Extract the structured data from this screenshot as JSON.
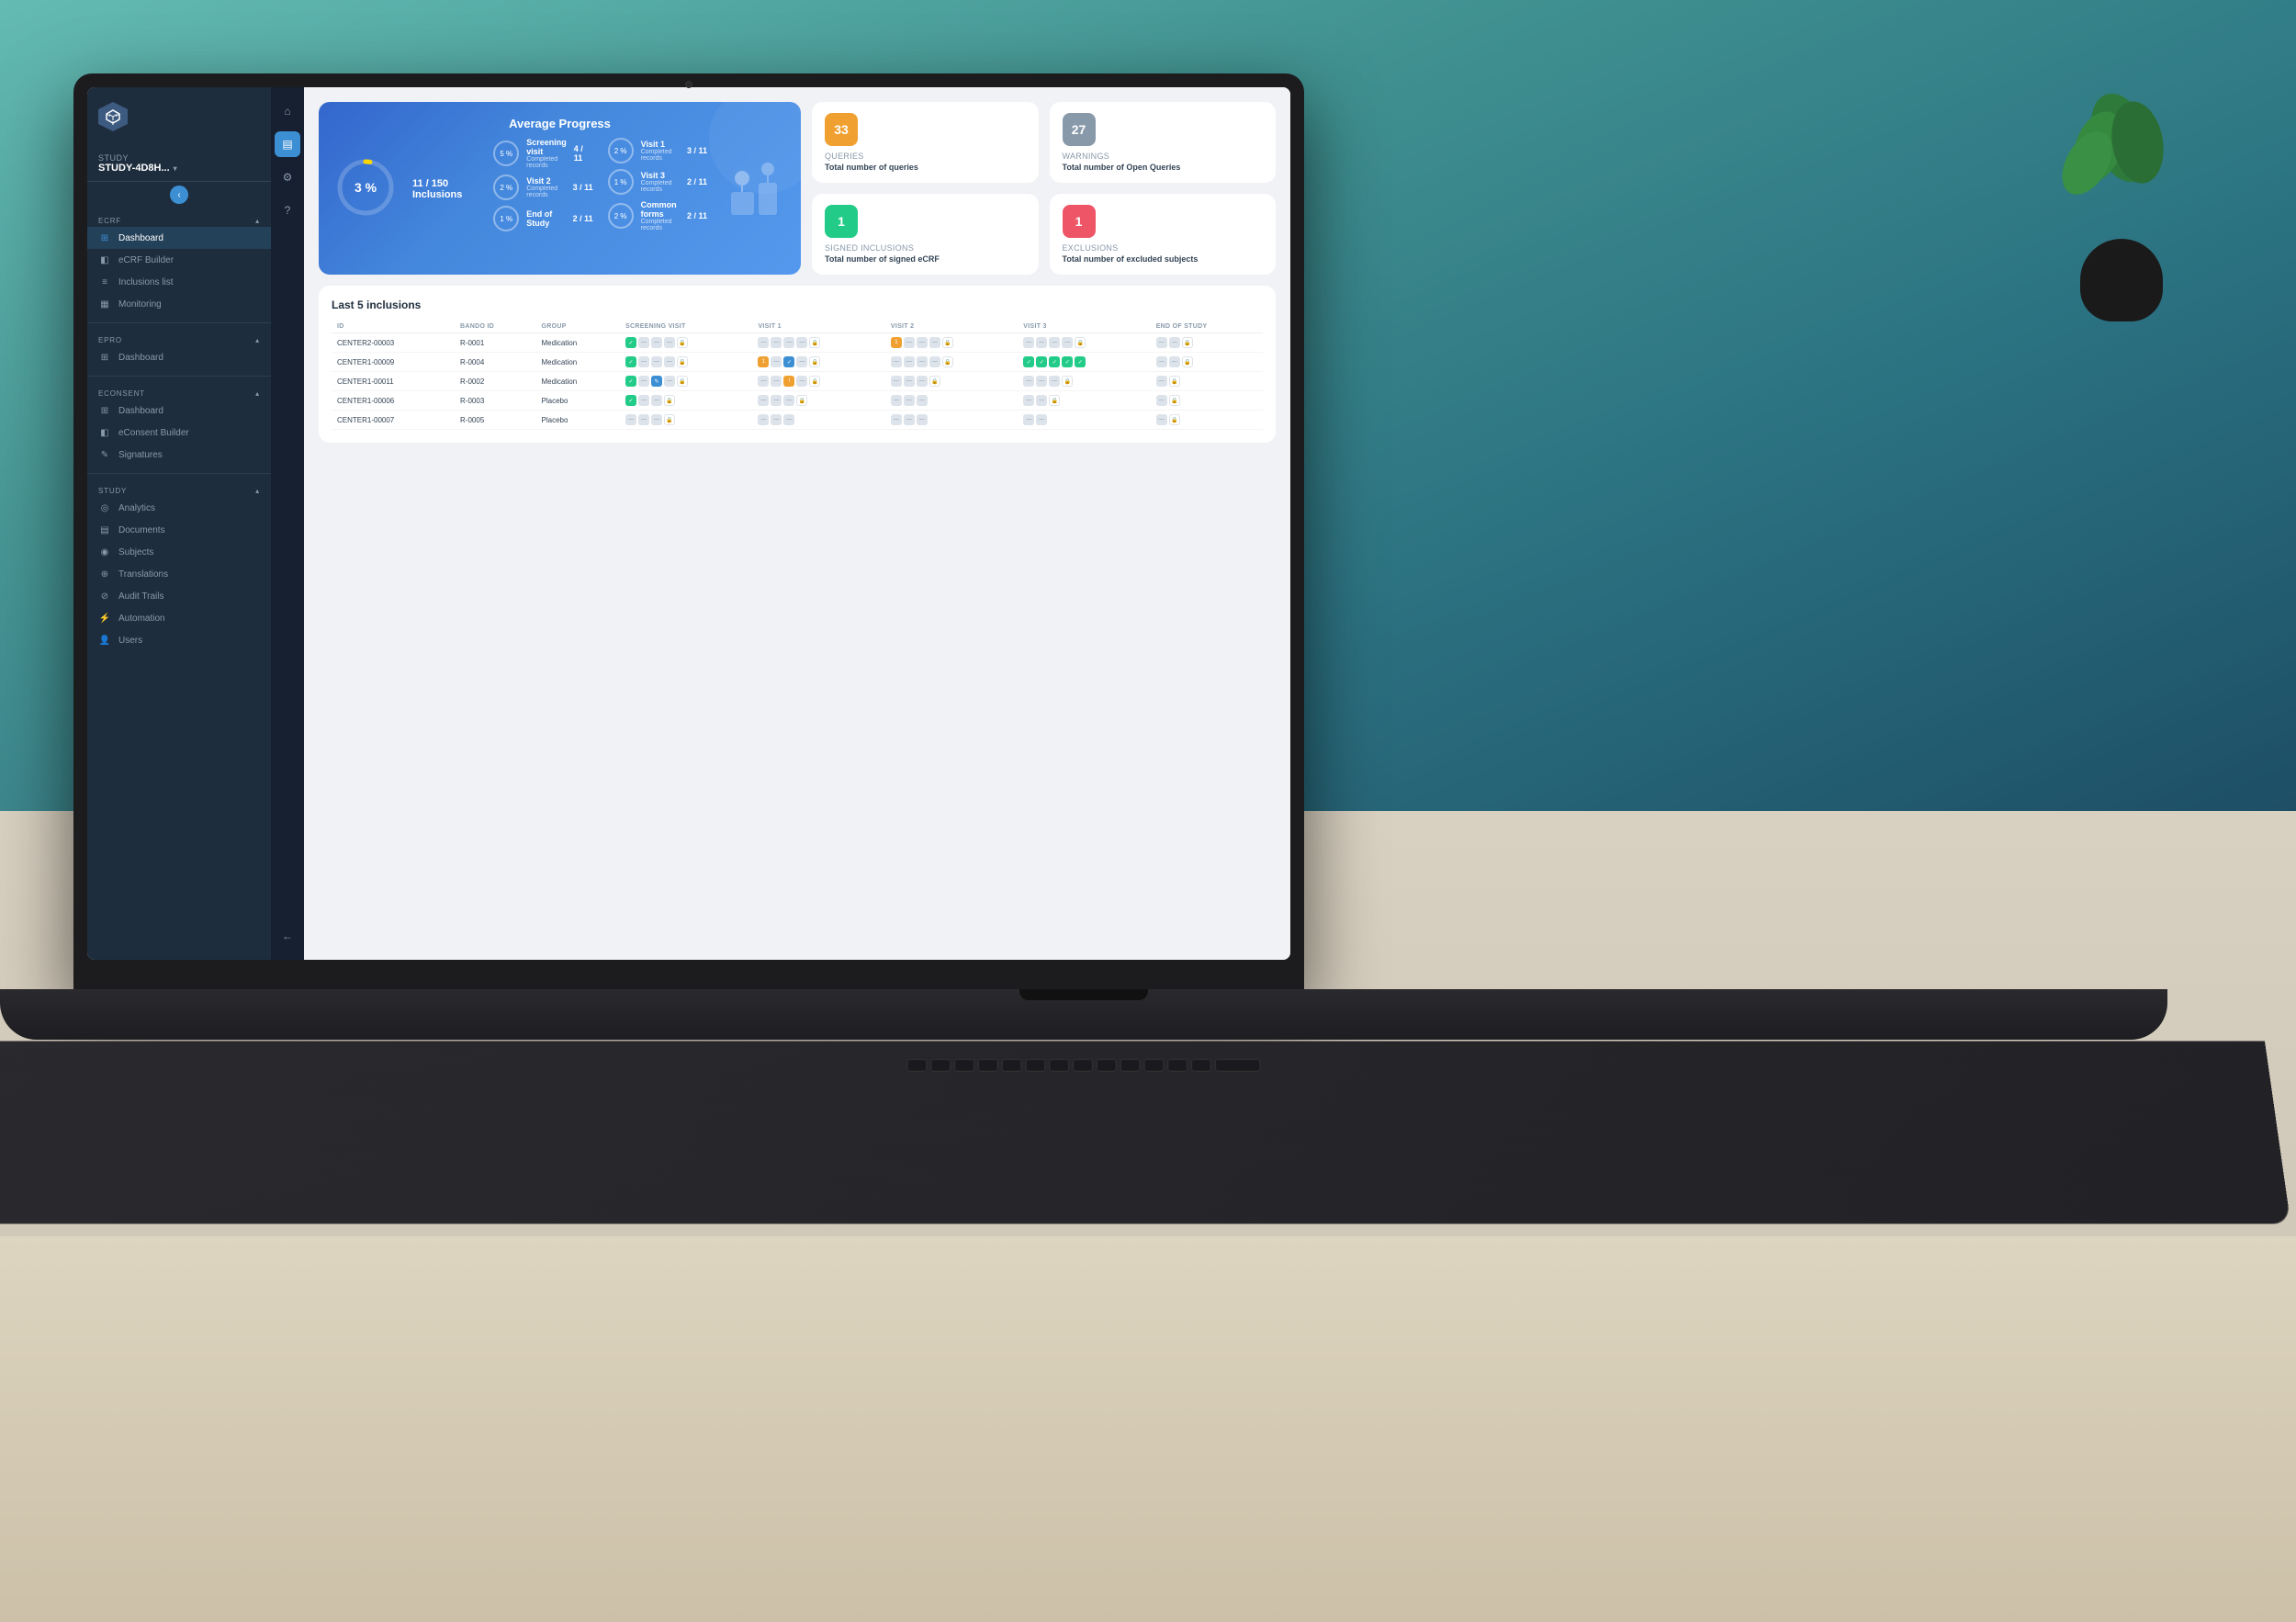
{
  "scene": {
    "background_color": "#1a3a4a"
  },
  "sidebar": {
    "study_label": "STUDY",
    "study_name": "STUDY-4D8H...",
    "ecrf_label": "eCRF",
    "epro_label": "ePRO",
    "econsent_label": "eConsent",
    "study_section_label": "Study",
    "nav_items": {
      "ecrf": [
        {
          "label": "Dashboard",
          "icon": "grid",
          "active": true
        },
        {
          "label": "eCRF Builder",
          "icon": "file",
          "active": false
        },
        {
          "label": "Inclusions list",
          "icon": "list",
          "active": false
        },
        {
          "label": "Monitoring",
          "icon": "bar-chart",
          "active": false
        }
      ],
      "epro": [
        {
          "label": "Dashboard",
          "icon": "grid",
          "active": false
        }
      ],
      "econsent": [
        {
          "label": "Dashboard",
          "icon": "grid",
          "active": false
        },
        {
          "label": "eConsent Builder",
          "icon": "file",
          "active": false
        },
        {
          "label": "Signatures",
          "icon": "pen",
          "active": false
        }
      ],
      "study": [
        {
          "label": "Analytics",
          "icon": "chart",
          "active": false
        },
        {
          "label": "Documents",
          "icon": "doc",
          "active": false
        },
        {
          "label": "Subjects",
          "icon": "users",
          "active": false
        },
        {
          "label": "Translations",
          "icon": "globe",
          "active": false
        },
        {
          "label": "Audit Trails",
          "icon": "shield",
          "active": false
        },
        {
          "label": "Automation",
          "icon": "bolt",
          "active": false
        },
        {
          "label": "Users",
          "icon": "person",
          "active": false
        }
      ]
    }
  },
  "avg_progress": {
    "title": "Average Progress",
    "percentage": "3 %",
    "inclusions": "11 / 150 Inclusions"
  },
  "visits": [
    {
      "name": "Screening visit",
      "sub": "Completed records",
      "pct": "5 %",
      "count": "4 / 11"
    },
    {
      "name": "Visit 2",
      "sub": "Completed records",
      "pct": "2 %",
      "count": "3 / 11"
    },
    {
      "name": "End of Study",
      "sub": "",
      "pct": "1 %",
      "count": "2 / 11"
    },
    {
      "name": "Visit 1",
      "sub": "Completed records",
      "pct": "2 %",
      "count": "3 / 11"
    },
    {
      "name": "Visit 3",
      "sub": "Completed records",
      "pct": "1 %",
      "count": "2 / 11"
    },
    {
      "name": "Common forms",
      "sub": "Completed records",
      "pct": "2 %",
      "count": "2 / 11"
    }
  ],
  "stats": {
    "queries": {
      "value": "33",
      "label": "Queries",
      "desc": "Total number of queries",
      "color": "orange"
    },
    "warnings": {
      "value": "27",
      "label": "Warnings",
      "desc": "Total number of Open Queries",
      "color": "gray"
    },
    "signed": {
      "value": "1",
      "label": "Signed inclusions",
      "desc": "Total number of signed eCRF",
      "color": "green"
    },
    "exclusions": {
      "value": "1",
      "label": "Exclusions",
      "desc": "Total number of excluded subjects",
      "color": "red"
    }
  },
  "inclusions_table": {
    "title": "Last 5 inclusions",
    "columns": {
      "id": "ID",
      "bando_id": "BANDO ID",
      "group": "GROUP",
      "screening_visit": "SCREENING VISIT",
      "visit_1": "VISIT 1",
      "visit_2": "VISIT 2",
      "visit_3": "VISIT 3",
      "end_of_study": "END OF STUDY"
    },
    "rows": [
      {
        "id": "CENTER2-00003",
        "bando_id": "R-0001",
        "group": "Medication"
      },
      {
        "id": "CENTER1-00009",
        "bando_id": "R-0004",
        "group": "Medication"
      },
      {
        "id": "CENTER1-00011",
        "bando_id": "R-0002",
        "group": "Medication"
      },
      {
        "id": "CENTER1-00006",
        "bando_id": "R-0003",
        "group": "Placebo"
      },
      {
        "id": "CENTER1-00007",
        "bando_id": "R-0005",
        "group": "Placebo"
      }
    ]
  }
}
